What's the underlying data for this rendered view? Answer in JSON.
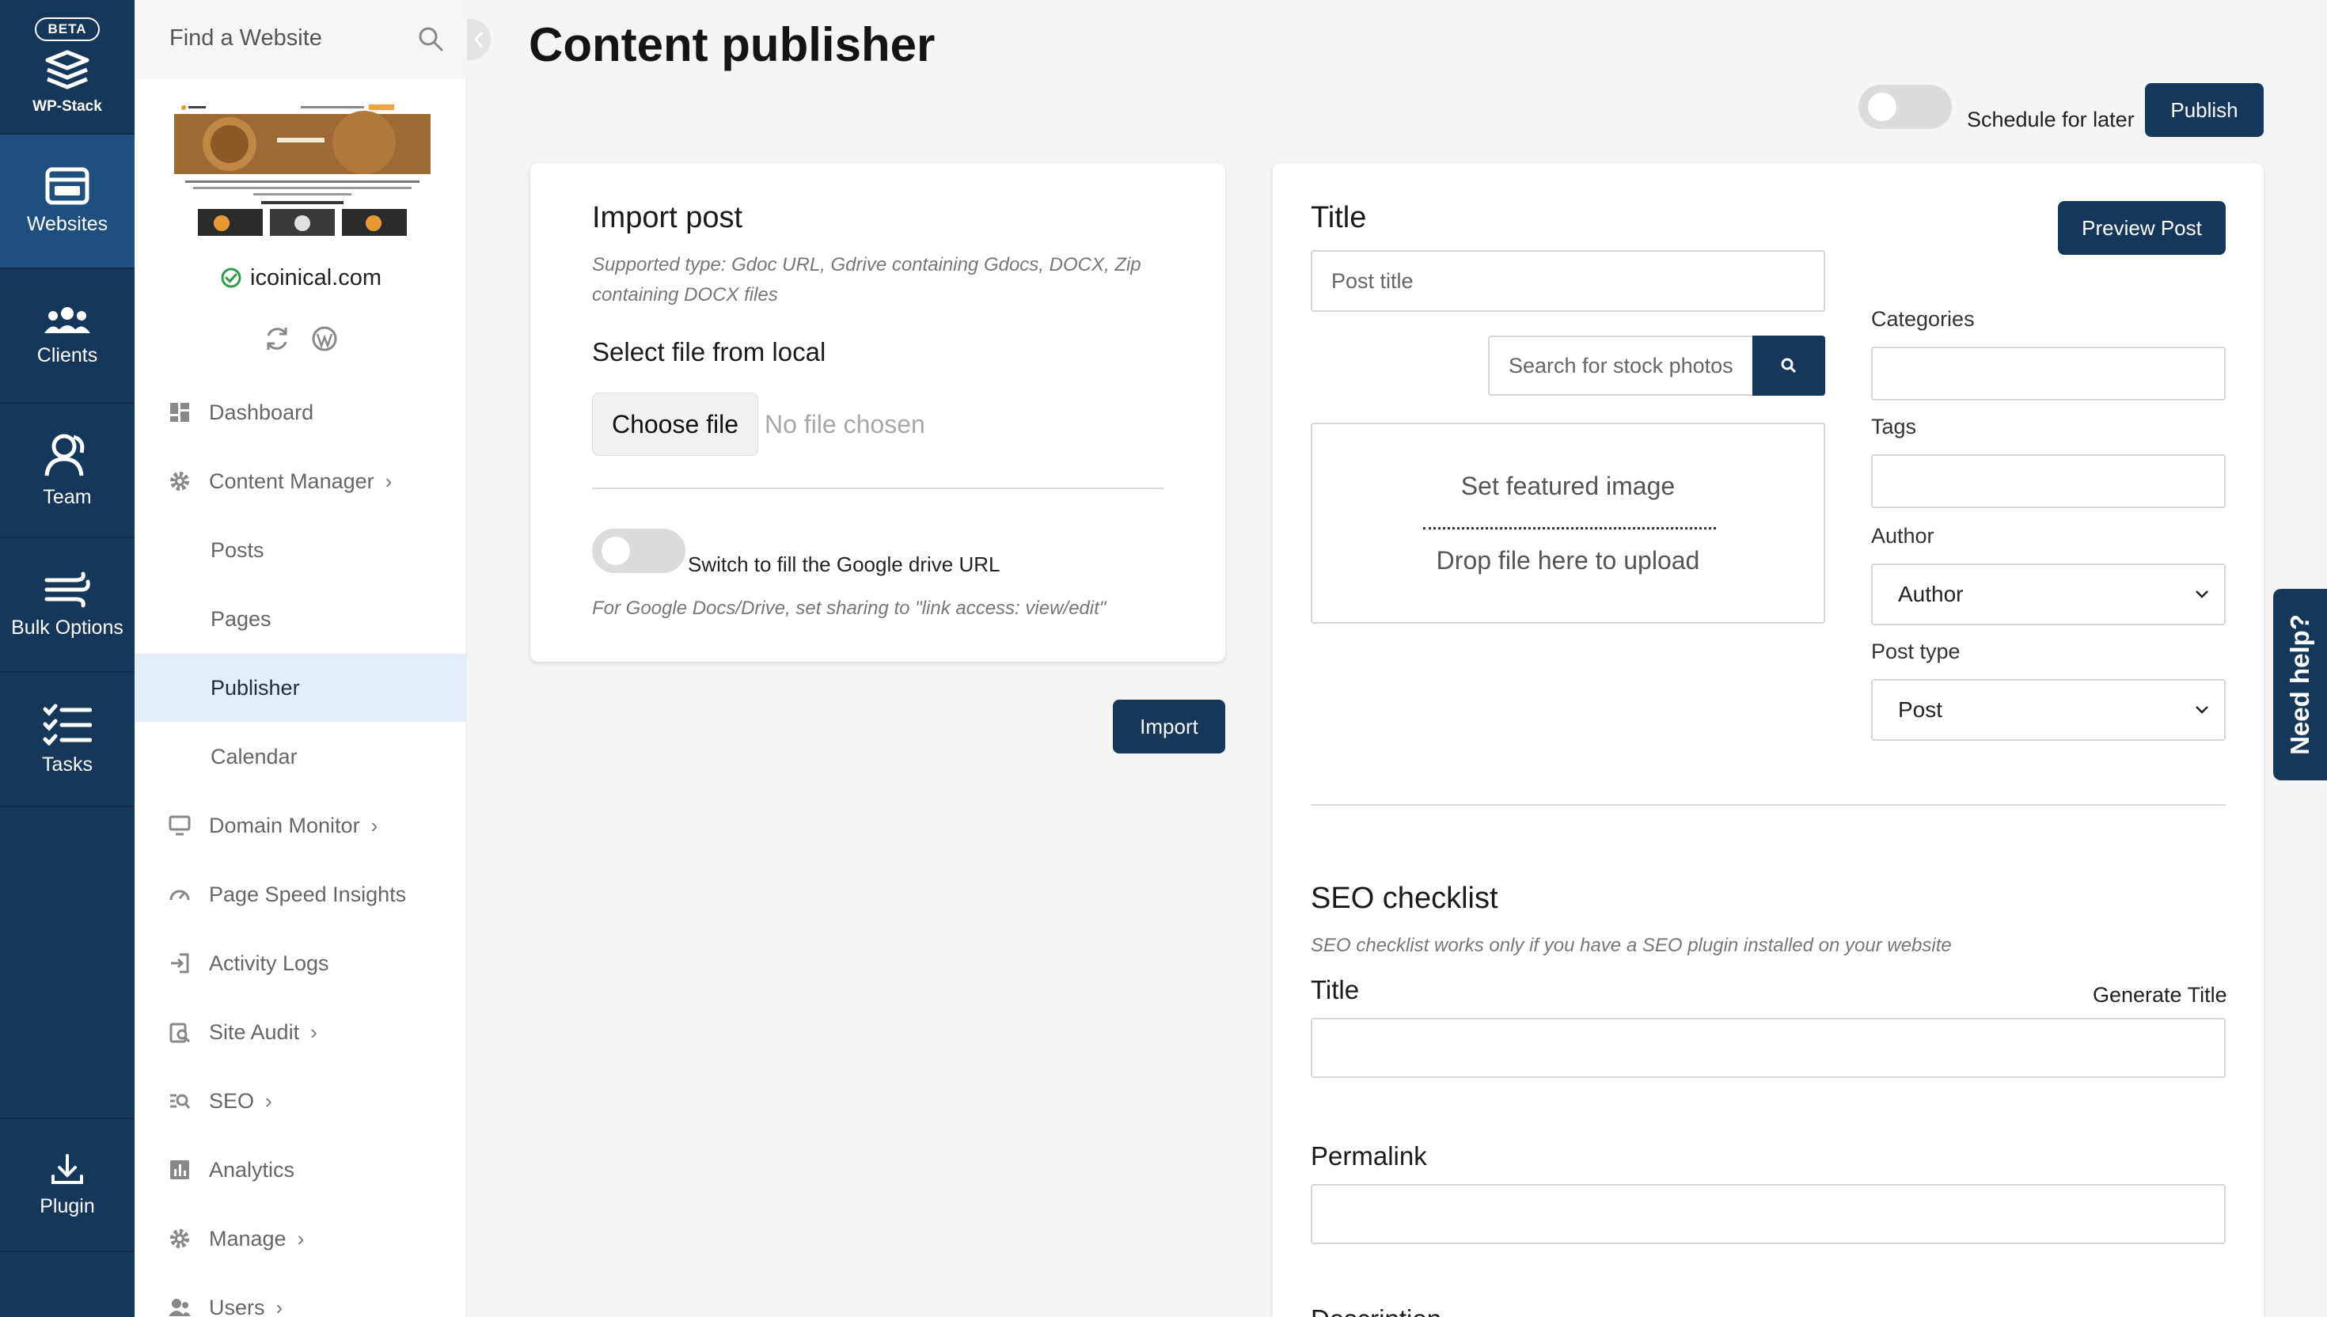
{
  "rail": {
    "beta": "BETA",
    "brand": "WP-Stack",
    "items": [
      {
        "label": "Websites",
        "icon": "websites-icon"
      },
      {
        "label": "Clients",
        "icon": "clients-icon"
      },
      {
        "label": "Team",
        "icon": "team-icon"
      },
      {
        "label": "Bulk Options",
        "icon": "bulk-options-icon"
      },
      {
        "label": "Tasks",
        "icon": "tasks-icon"
      },
      {
        "label": "Plugin",
        "icon": "plugin-download-icon"
      }
    ]
  },
  "sidebar": {
    "search_placeholder": "Find a Website",
    "site_name": "icoinical.com",
    "menu": [
      {
        "label": "Dashboard"
      },
      {
        "label": "Content Manager"
      },
      {
        "label": "Posts"
      },
      {
        "label": "Pages"
      },
      {
        "label": "Publisher"
      },
      {
        "label": "Calendar"
      },
      {
        "label": "Domain Monitor"
      },
      {
        "label": "Page Speed Insights"
      },
      {
        "label": "Activity Logs"
      },
      {
        "label": "Site Audit"
      },
      {
        "label": "SEO"
      },
      {
        "label": "Analytics"
      },
      {
        "label": "Manage"
      },
      {
        "label": "Users"
      }
    ]
  },
  "main": {
    "title": "Content publisher",
    "schedule_label": "Schedule for later",
    "publish_label": "Publish"
  },
  "import_card": {
    "heading": "Import post",
    "supported_line1": "Supported type: Gdoc URL, Gdrive containing Gdocs, DOCX, Zip",
    "supported_line2": "containing DOCX files",
    "select_local": "Select file from local",
    "choose_file": "Choose file",
    "no_file": "No file chosen",
    "switch_label": "Switch to fill the Google drive URL",
    "drive_hint": "For Google Docs/Drive, set sharing to \"link access: view/edit\"",
    "import_button": "Import"
  },
  "post_card": {
    "title_label": "Title",
    "title_placeholder": "Post title",
    "preview_button": "Preview Post",
    "stock_placeholder": "Search for stock photos",
    "featured_image": "Set featured image",
    "drop_file": "Drop file here to upload",
    "categories_label": "Categories",
    "tags_label": "Tags",
    "author_label": "Author",
    "author_value": "Author",
    "post_type_label": "Post type",
    "post_type_value": "Post",
    "seo_heading": "SEO checklist",
    "seo_hint": "SEO checklist works only if you have a SEO plugin installed on your website",
    "seo_title_label": "Title",
    "generate_title": "Generate Title",
    "permalink_label": "Permalink",
    "description_label": "Description"
  },
  "help_tab": "Need help?",
  "colors": {
    "navy": "#14375a",
    "rail_active": "#1f4f7e",
    "menu_active_bg": "#e3eef8",
    "success_green": "#2e9d4a"
  }
}
